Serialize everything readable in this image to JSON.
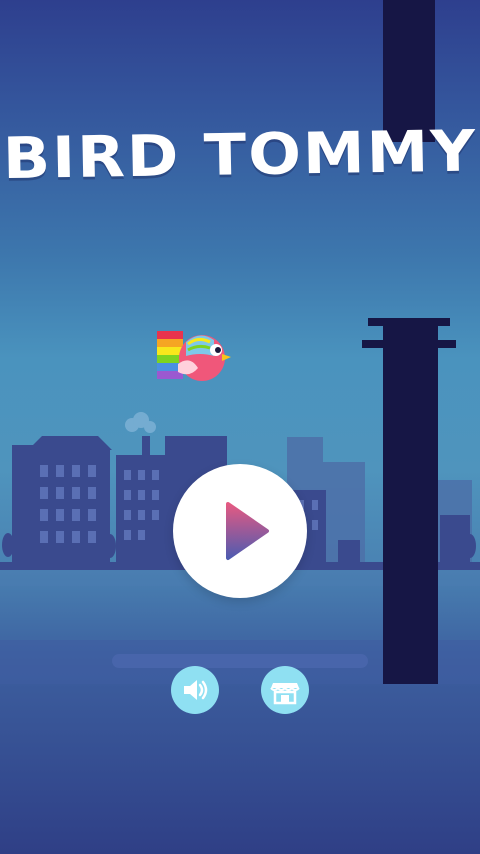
{
  "game": {
    "title": "BIRD TOMMY"
  },
  "colors": {
    "sky_top": "#2e3f8e",
    "sky_mid": "#4f94bd",
    "pipe": "#161645",
    "city": "#37478a",
    "bird": "#f0577a",
    "play_triangle_top": "#e45a82",
    "play_triangle_bottom": "#4f5bb0",
    "button_light": "#8fe0f2"
  },
  "icons": {
    "play": "play-icon",
    "sound": "speaker-icon",
    "shop": "shop-icon"
  }
}
